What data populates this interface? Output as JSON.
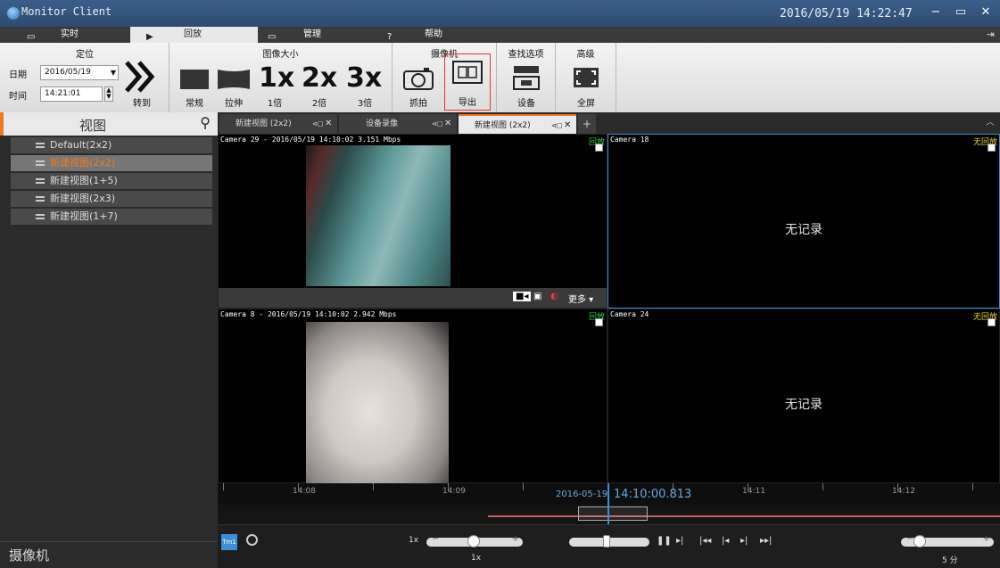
{
  "window": {
    "title": "Monitor Client",
    "clock": "2016/05/19 14:22:47"
  },
  "menu_tabs": [
    {
      "label": "实时",
      "icon": "monitor-icon"
    },
    {
      "label": "回放",
      "icon": "play-icon"
    },
    {
      "label": "管理",
      "icon": "folder-icon"
    },
    {
      "label": "帮助",
      "icon": "help-icon"
    }
  ],
  "ribbon": {
    "locate": {
      "title": "定位",
      "date_label": "日期",
      "date_value": "2016/05/19",
      "time_label": "时间",
      "time_value": "14:21:01",
      "goto_label": "转到"
    },
    "image_size": {
      "title": "图像大小",
      "normal": "常规",
      "stretch": "拉伸",
      "x1": "1倍",
      "x2": "2倍",
      "x3": "3倍"
    },
    "camera": {
      "title": "摄像机",
      "snapshot": "抓拍",
      "export": "导出"
    },
    "search": {
      "title": "查找选项",
      "device": "设备"
    },
    "advanced": {
      "title": "高级",
      "fullscreen": "全屏"
    }
  },
  "views": {
    "title": "视图",
    "items": [
      "Default(2x2)",
      "新建视图(2x2)",
      "新建视图(1+5)",
      "新建视图(2x3)",
      "新建视图(1+7)"
    ],
    "footer": "摄像机"
  },
  "view_tabs": [
    {
      "label": "新建视图 (2x2)",
      "active": false
    },
    {
      "label": "设备录像",
      "active": false
    },
    {
      "label": "新建视图 (2x2)",
      "active": true
    }
  ],
  "cameras": [
    {
      "label": "Camera 29 - 2016/05/19 14:10:02 3.151 Mbps",
      "status": "回放",
      "no_record": ""
    },
    {
      "label": "Camera 18",
      "status": "无回放",
      "no_record": "无记录"
    },
    {
      "label": "Camera 8 - 2016/05/19 14:10:02 2.942 Mbps",
      "status": "回放",
      "no_record": ""
    },
    {
      "label": "Camera 24",
      "status": "无回放",
      "no_record": "无记录"
    }
  ],
  "overlay": {
    "more_label": "更多"
  },
  "timeline": {
    "ticks": [
      "14:08",
      "14:09",
      "14:11",
      "14:12"
    ],
    "current_date": "2016-05-19",
    "current_time": "14:10:00.813"
  },
  "controls": {
    "speed_label": "1x",
    "speed_value": "1x",
    "range_label": "5 分"
  }
}
